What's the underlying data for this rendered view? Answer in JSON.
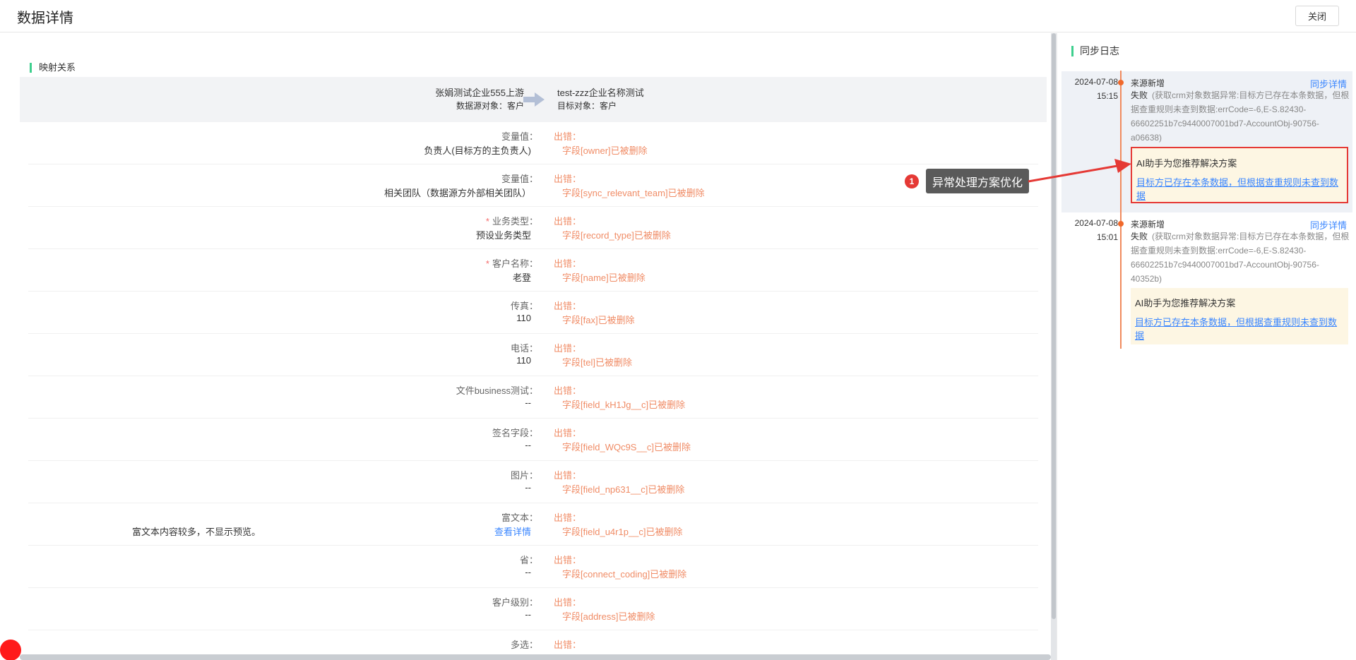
{
  "header": {
    "title": "数据详情",
    "close_label": "关闭"
  },
  "mapping": {
    "section_title": "映射关系",
    "source_name": "张娟测试企业555上游",
    "source_object": "数据源对象：客户",
    "target_name": "test-zzz企业名称测试",
    "target_object": "目标对象：客户"
  },
  "rows": [
    {
      "label": "变量值：",
      "required": false,
      "value": "负责人(目标方的主负责人)",
      "error_title": "出错：",
      "error_detail": "字段[owner]已被删除"
    },
    {
      "label": "变量值：",
      "required": false,
      "value": "相关团队（数据源方外部相关团队）",
      "error_title": "出错：",
      "error_detail": "字段[sync_relevant_team]已被删除"
    },
    {
      "label": "业务类型：",
      "required": true,
      "value": "预设业务类型",
      "error_title": "出错：",
      "error_detail": "字段[record_type]已被删除"
    },
    {
      "label": "客户名称：",
      "required": true,
      "value": "老登",
      "error_title": "出错：",
      "error_detail": "字段[name]已被删除"
    },
    {
      "label": "传真：",
      "required": false,
      "value": "110",
      "error_title": "出错：",
      "error_detail": "字段[fax]已被删除"
    },
    {
      "label": "电话：",
      "required": false,
      "value": "110",
      "error_title": "出错：",
      "error_detail": "字段[tel]已被删除"
    },
    {
      "label": "文件business测试：",
      "required": false,
      "value": "--",
      "error_title": "出错：",
      "error_detail": "字段[field_kH1Jg__c]已被删除"
    },
    {
      "label": "签名字段：",
      "required": false,
      "value": "--",
      "error_title": "出错：",
      "error_detail": "字段[field_WQc9S__c]已被删除"
    },
    {
      "label": "图片：",
      "required": false,
      "value": "--",
      "error_title": "出错：",
      "error_detail": "字段[field_np631__c]已被删除"
    },
    {
      "label": "富文本：",
      "required": false,
      "value": "查看详情",
      "extra": "富文本内容较多，不显示预览。",
      "error_title": "出错：",
      "error_detail": "字段[field_u4r1p__c]已被删除"
    },
    {
      "label": "省：",
      "required": false,
      "value": "--",
      "error_title": "出错：",
      "error_detail": "字段[connect_coding]已被删除"
    },
    {
      "label": "客户级别：",
      "required": false,
      "value": "--",
      "error_title": "出错：",
      "error_detail": "字段[address]已被删除"
    },
    {
      "label": "多选：",
      "required": false,
      "value": "",
      "error_title": "出错：",
      "error_detail": ""
    }
  ],
  "annotation": {
    "number": "1",
    "label": "异常处理方案优化"
  },
  "sync_log": {
    "title": "同步日志",
    "entries": [
      {
        "date": "2024-07-08",
        "time": "15:15",
        "kind": "来源新增",
        "detail_link": "同步详情",
        "status": "失败",
        "message": "(获取crm对象数据异常:目标方已存在本条数据，但根据查重规则未查到数据:errCode=-6,E-S.82430-66602251b7c9440007001bd7-AccountObj-90756-a06638)",
        "ai_title": "AI助手为您推荐解决方案",
        "ai_link": "目标方已存在本条数据，但根据查重规则未查到数据"
      },
      {
        "date": "2024-07-08",
        "time": "15:01",
        "kind": "来源新增",
        "detail_link": "同步详情",
        "status": "失败",
        "message": "(获取crm对象数据异常:目标方已存在本条数据，但根据查重规则未查到数据:errCode=-6,E-S.82430-66602251b7c9440007001bd7-AccountObj-90756-40352b)",
        "ai_title": "AI助手为您推荐解决方案",
        "ai_link": "目标方已存在本条数据，但根据查重规则未查到数据"
      }
    ]
  },
  "colors": {
    "accent_green": "#3ecf8e",
    "error_orange": "#f08c66",
    "link_blue": "#3a86ff",
    "annotation_red": "#e53935"
  }
}
